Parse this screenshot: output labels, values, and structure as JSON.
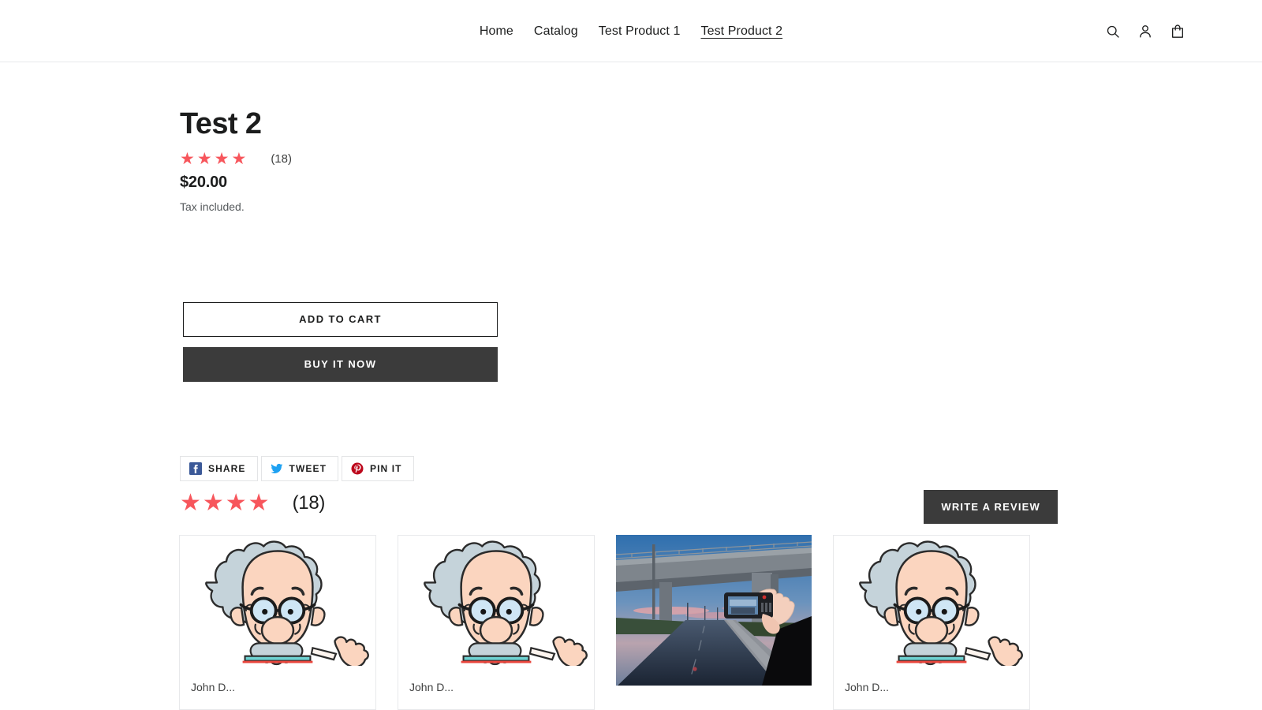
{
  "header": {
    "nav": [
      {
        "label": "Home",
        "active": false
      },
      {
        "label": "Catalog",
        "active": false
      },
      {
        "label": "Test Product 1",
        "active": false
      },
      {
        "label": "Test Product 2",
        "active": true
      }
    ],
    "icons": [
      {
        "name": "search-icon",
        "label": "Search"
      },
      {
        "name": "account-icon",
        "label": "Log in"
      },
      {
        "name": "cart-icon",
        "label": "Cart"
      }
    ]
  },
  "product": {
    "title": "Test 2",
    "stars": "★★★★",
    "star_count": 4,
    "star_color": "#f7565c",
    "review_count": "(18)",
    "price": "$20.00",
    "tax_note": "Tax included.",
    "add_to_cart_label": "ADD TO CART",
    "buy_now_label": "BUY IT NOW"
  },
  "share": {
    "buttons": [
      {
        "label": "SHARE",
        "icon": "facebook-icon",
        "color": "#3b5998"
      },
      {
        "label": "TWEET",
        "icon": "twitter-icon",
        "color": "#1da1f2"
      },
      {
        "label": "PIN IT",
        "icon": "pinterest-icon",
        "color": "#bd081c"
      }
    ]
  },
  "reviews": {
    "stars": "★★★★",
    "count_label": "(18)",
    "write_review_label": "WRITE A REVIEW",
    "cards": [
      {
        "author": "John D...",
        "image": "cartoon-scientist"
      },
      {
        "author": "John D...",
        "image": "cartoon-scientist"
      },
      {
        "author": "",
        "image": "overpass-road-photo"
      },
      {
        "author": "John D...",
        "image": "cartoon-scientist"
      }
    ]
  }
}
